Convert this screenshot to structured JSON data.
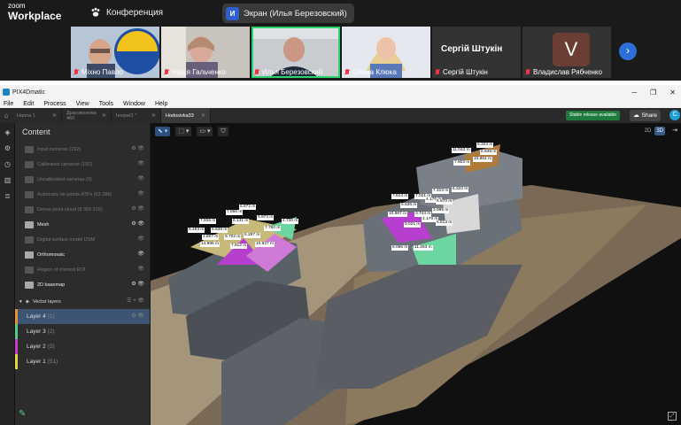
{
  "zoom": {
    "logo_line1": "zoom",
    "logo_line2": "Workplace",
    "meeting_title": "Конференция",
    "share_badge": "И",
    "screen_label": "Экран (Илья Березовский)"
  },
  "participants": [
    {
      "name": "Міхно Павло",
      "active": false
    },
    {
      "name": "Надія Гальченко",
      "active": false
    },
    {
      "name": "Илья Березовский",
      "active": true
    },
    {
      "name": "Олена Клюка",
      "active": false
    },
    {
      "name": "Сергій Штукін",
      "big_name": "Сергій Штукін",
      "active": false
    },
    {
      "name": "Владислав Рябченко",
      "avatar_letter": "V",
      "active": false
    }
  ],
  "app": {
    "window_title": "PIX4Dmatic",
    "menu": [
      "File",
      "Edit",
      "Process",
      "View",
      "Tools",
      "Window",
      "Help"
    ],
    "tabs": [
      {
        "label": "Hanna 1",
        "active": false
      },
      {
        "label": "Драгоманова 46б",
        "active": false
      },
      {
        "label": "hnopel1 *",
        "active": false
      },
      {
        "label": "Hodosivka33",
        "active": true
      }
    ],
    "stable_label": "Stable release available",
    "share_label": "Share",
    "user_initial": "C"
  },
  "panel": {
    "title": "Content",
    "items": [
      {
        "label": "Input cameras (192)",
        "on": false,
        "actions": "⚙ 👁"
      },
      {
        "label": "Calibrated cameras (192)",
        "on": false,
        "actions": "👁"
      },
      {
        "label": "Uncalibrated cameras (0)",
        "on": false,
        "actions": "👁"
      },
      {
        "label": "Automatic tie points ATPs (63 289)",
        "on": false,
        "actions": "👁"
      },
      {
        "label": "Dense point cloud (8 358 215)",
        "on": false,
        "actions": "⚙ 👁"
      },
      {
        "label": "Mesh",
        "on": true,
        "actions": "⚙ 👁"
      },
      {
        "label": "Digital surface model DSM",
        "on": false,
        "actions": "👁"
      },
      {
        "label": "Orthomosaic",
        "on": true,
        "actions": "👁"
      },
      {
        "label": "Region of interest ROI",
        "on": false,
        "actions": "👁"
      },
      {
        "label": "2D basemap",
        "on": true,
        "actions": "⚙ 👁"
      }
    ],
    "vector_header": "Vector layers",
    "layers": [
      {
        "label": "Layer 4",
        "count": "(1)",
        "color": "#e0932e",
        "selected": true
      },
      {
        "label": "Layer 3",
        "count": "(2)",
        "color": "#4ed08a",
        "selected": false
      },
      {
        "label": "Layer 2",
        "count": "(2)",
        "color": "#c23fd1",
        "selected": false
      },
      {
        "label": "Layer 1",
        "count": "(51)",
        "color": "#e8d23b",
        "selected": false
      }
    ]
  },
  "viewport": {
    "view_2d": "2D",
    "view_3d": "3D",
    "measurements": [
      {
        "text": "6.872 m"
      },
      {
        "text": "7.866 m"
      },
      {
        "text": "7.826 m"
      },
      {
        "text": "6.131 m"
      },
      {
        "text": "5.973 m"
      },
      {
        "text": "4.720 m"
      },
      {
        "text": "5.483 m"
      },
      {
        "text": "5.638 m"
      },
      {
        "text": "7.760 m"
      },
      {
        "text": "1.607 m"
      },
      {
        "text": "9.702 m"
      },
      {
        "text": "5.297 m"
      },
      {
        "text": "14.995 m"
      },
      {
        "text": "7.812 m"
      },
      {
        "text": "10.927 m"
      },
      {
        "text": "6.322 m"
      },
      {
        "text": "11.042 m"
      },
      {
        "text": "6.849 m"
      },
      {
        "text": "10.864 m"
      },
      {
        "text": "7.903 m"
      },
      {
        "text": "7.614 m"
      },
      {
        "text": "7.021 m"
      },
      {
        "text": "7.403 m"
      },
      {
        "text": "5.536 m"
      },
      {
        "text": "4.176 m"
      },
      {
        "text": "3.995 m"
      },
      {
        "text": "10.867 m"
      },
      {
        "text": "3.744 m"
      },
      {
        "text": "4.178 m"
      },
      {
        "text": "9.021 m"
      },
      {
        "text": "5.513 m"
      },
      {
        "text": "8.066 m"
      },
      {
        "text": "11.263 m"
      },
      {
        "text": "5.870 m"
      },
      {
        "text": "6.322 m"
      }
    ]
  }
}
